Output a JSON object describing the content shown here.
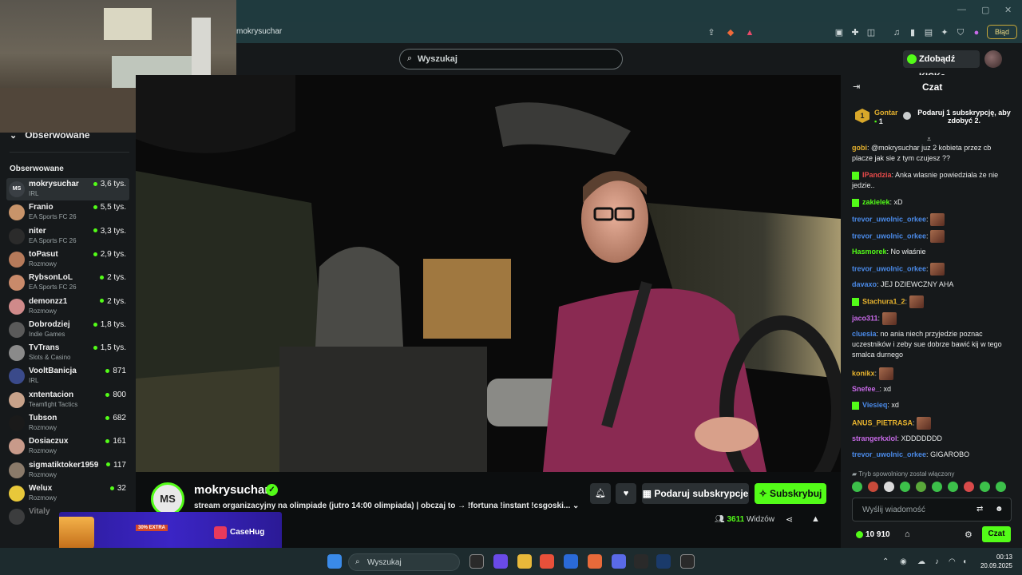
{
  "browser": {
    "url": "mokrysuchar",
    "error_label": "Błąd"
  },
  "header": {
    "search_placeholder": "Wyszukaj",
    "kicks_button": "Zdobądź KICKs"
  },
  "sidebar": {
    "collapse_label": "Obserwowane",
    "section_title": "Obserwowane",
    "channels": [
      {
        "initials": "MS",
        "name": "mokrysuchar",
        "category": "IRL",
        "viewers": "3,6 tys.",
        "active": true,
        "avatar_color": "#3a3f44"
      },
      {
        "initials": "",
        "name": "Franio",
        "category": "EA Sports FC 26",
        "viewers": "5,5 tys.",
        "active": false,
        "avatar_color": "#c8946a"
      },
      {
        "initials": "",
        "name": "niter",
        "category": "EA Sports FC 26",
        "viewers": "3,3 tys.",
        "active": false,
        "avatar_color": "#2b2b2b"
      },
      {
        "initials": "",
        "name": "toPasut",
        "category": "Rozmowy",
        "viewers": "2,9 tys.",
        "active": false,
        "avatar_color": "#b67a5a"
      },
      {
        "initials": "",
        "name": "RybsonLoL",
        "category": "EA Sports FC 26",
        "viewers": "2 tys.",
        "active": false,
        "avatar_color": "#c98a6a"
      },
      {
        "initials": "",
        "name": "demonzz1",
        "category": "Rozmowy",
        "viewers": "2 tys.",
        "active": false,
        "avatar_color": "#d08a8a"
      },
      {
        "initials": "",
        "name": "Dobrodziej",
        "category": "Indie Games",
        "viewers": "1,8 tys.",
        "active": false,
        "avatar_color": "#5a5a5a"
      },
      {
        "initials": "",
        "name": "TvTrans",
        "category": "Slots & Casino",
        "viewers": "1,5 tys.",
        "active": false,
        "avatar_color": "#8a8a8a"
      },
      {
        "initials": "",
        "name": "VooltBanicja",
        "category": "IRL",
        "viewers": "871",
        "active": false,
        "avatar_color": "#3a4a8a"
      },
      {
        "initials": "",
        "name": "xntentacion",
        "category": "Teamfight Tactics",
        "viewers": "800",
        "active": false,
        "avatar_color": "#c8a28a"
      },
      {
        "initials": "",
        "name": "Tubson",
        "category": "Rozmowy",
        "viewers": "682",
        "active": false,
        "avatar_color": "#1a1a1a"
      },
      {
        "initials": "",
        "name": "Dosiaczux",
        "category": "Rozmowy",
        "viewers": "161",
        "active": false,
        "avatar_color": "#c89a8a"
      },
      {
        "initials": "",
        "name": "sigmatiktoker1959",
        "category": "Rozmowy",
        "viewers": "117",
        "active": false,
        "avatar_color": "#8a7a6a"
      },
      {
        "initials": "",
        "name": "Welux",
        "category": "Rozmowy",
        "viewers": "32",
        "active": false,
        "avatar_color": "#e8c83a"
      },
      {
        "initials": "",
        "name": "Vitaly",
        "category": "",
        "viewers": "",
        "active": false,
        "avatar_color": "#6a6a6a"
      }
    ]
  },
  "ad": {
    "promo": "30% EXTRA",
    "brand": "CaseHug"
  },
  "stream": {
    "logo_initials": "MS",
    "channel_name": "mokrysuchar",
    "description": "stream organizacyjny na olimpiade (jutro 14:00 olimpiada) | obczaj to → !fortuna !instant !csgoski...",
    "gift_button": "Podaruj subskrypcje",
    "subscribe_button": "Subskrybuj",
    "viewer_count": "3611",
    "viewer_label": "Widzów"
  },
  "chat": {
    "title": "Czat",
    "pinned": {
      "rank": "1",
      "user": "Gontar",
      "count": "1",
      "text": "Podaruj 1 subskrypcję, aby zdobyć 2."
    },
    "messages": [
      {
        "user": "gobi",
        "color": "#e6b22e",
        "text": "@mokrysuchar juz 2 kobieta przez cb placze jak sie z tym czujesz ??",
        "badge": false,
        "emote": false
      },
      {
        "user": "IPandzia",
        "color": "#e84a4a",
        "text": "Anka wlasnie powiedziala że nie jedzie..",
        "badge": true,
        "emote": false
      },
      {
        "user": "zakielek",
        "color": "#53fc18",
        "text": "xD",
        "badge": true,
        "emote": false
      },
      {
        "user": "trevor_uwolnic_orkee",
        "color": "#4a8ae8",
        "text": "",
        "badge": false,
        "emote": true
      },
      {
        "user": "trevor_uwolnic_orkee",
        "color": "#4a8ae8",
        "text": "",
        "badge": false,
        "emote": true
      },
      {
        "user": "Hasmorek",
        "color": "#53fc18",
        "text": "No właśnie",
        "badge": false,
        "emote": false
      },
      {
        "user": "trevor_uwolnic_orkee",
        "color": "#4a8ae8",
        "text": "",
        "badge": false,
        "emote": true
      },
      {
        "user": "davaxo",
        "color": "#4a8ae8",
        "text": "JEJ DZIEWCZNY AHA",
        "badge": false,
        "emote": false
      },
      {
        "user": "Stachura1_2",
        "color": "#e6b22e",
        "text": "",
        "badge": true,
        "emote": true
      },
      {
        "user": "jaco311",
        "color": "#c86ae8",
        "text": "",
        "badge": false,
        "emote": true
      },
      {
        "user": "cluesia",
        "color": "#4a8ae8",
        "text": "no ania niech przyjedzie poznac uczestników i zeby sue dobrze bawić kij w tego smalca durnego",
        "badge": false,
        "emote": false
      },
      {
        "user": "konikx",
        "color": "#e6b22e",
        "text": "",
        "badge": false,
        "emote": true
      },
      {
        "user": "Snefee_",
        "color": "#c86ae8",
        "text": "xd",
        "badge": false,
        "emote": false
      },
      {
        "user": "Viesieq",
        "color": "#4a8ae8",
        "text": "xd",
        "badge": true,
        "emote": false
      },
      {
        "user": "ANUS_PIETRASA",
        "color": "#e6b22e",
        "text": "",
        "badge": false,
        "emote": true
      },
      {
        "user": "strangerkxlol",
        "color": "#c86ae8",
        "text": "XDDDDDDD",
        "badge": false,
        "emote": false
      },
      {
        "user": "trevor_uwolnic_orkee",
        "color": "#4a8ae8",
        "text": "GIGAROBO",
        "badge": false,
        "emote": false
      }
    ],
    "slow_mode": "Tryb spowolniony został włączony",
    "input_placeholder": "Wyślij wiadomość",
    "kicks_balance": "10 910",
    "send_button": "Czat"
  },
  "taskbar": {
    "search_placeholder": "Wyszukaj",
    "time": "00:13",
    "date": "20.09.2025"
  }
}
